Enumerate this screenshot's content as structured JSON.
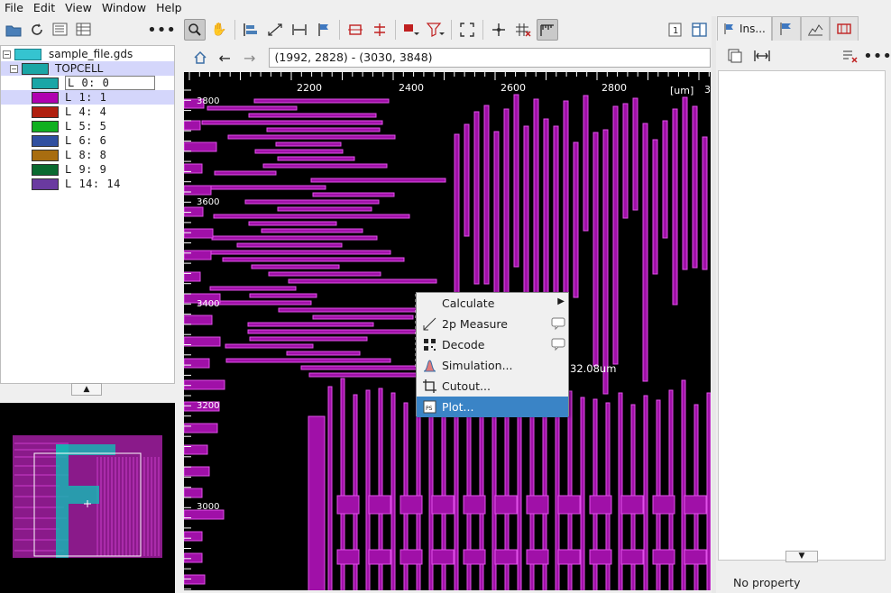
{
  "menubar": {
    "items": [
      {
        "label": "File"
      },
      {
        "label": "Edit"
      },
      {
        "label": "View"
      },
      {
        "label": "Window"
      },
      {
        "label": "Help"
      }
    ]
  },
  "left_toolbar": {
    "icons": [
      "open-folder-icon",
      "reload-icon",
      "layer-list-icon",
      "layer-table-icon",
      "more-options-icon"
    ]
  },
  "cell_tree": {
    "file_name": "sample_file.gds",
    "top_cell": "TOPCELL",
    "layers": [
      {
        "label": "L  0:  0",
        "color": "#1aa6a6",
        "selected": false,
        "boxed": true
      },
      {
        "label": "L  1:  1",
        "color": "#b000b0",
        "selected": true,
        "boxed": false
      },
      {
        "label": "L  4:  4",
        "color": "#b02010",
        "selected": false,
        "boxed": false
      },
      {
        "label": "L  5:  5",
        "color": "#10b020",
        "selected": false,
        "boxed": false
      },
      {
        "label": "L  6:  6",
        "color": "#3050a0",
        "selected": false,
        "boxed": false
      },
      {
        "label": "L  8:  8",
        "color": "#a86d10",
        "selected": false,
        "boxed": false
      },
      {
        "label": "L  9:  9",
        "color": "#0a6a30",
        "selected": false,
        "boxed": false
      },
      {
        "label": "L 14: 14",
        "color": "#6a3aa0",
        "selected": false,
        "boxed": false
      }
    ]
  },
  "navigation": {
    "coordinates": "(1992, 2828) - (3030, 3848)"
  },
  "ruler": {
    "x_ticks": [
      "2200",
      "2400",
      "2600",
      "2800"
    ],
    "unit": "[um]",
    "right_edge": "3",
    "y_ticks": [
      "3800",
      "3600",
      "3400",
      "3200",
      "3000"
    ]
  },
  "measurement_text": "32.08um",
  "context_menu": {
    "items": [
      {
        "label": "Calculate",
        "icon": "",
        "submenu": true,
        "active": false
      },
      {
        "label": "2p Measure",
        "icon": "measure-icon",
        "submenu": false,
        "active": false,
        "comment": true
      },
      {
        "label": "Decode",
        "icon": "qr-code-icon",
        "submenu": false,
        "active": false,
        "comment": true
      },
      {
        "label": "Simulation...",
        "icon": "simulation-icon",
        "submenu": false,
        "active": false
      },
      {
        "label": "Cutout...",
        "icon": "crop-icon",
        "submenu": false,
        "active": false
      },
      {
        "label": "Plot...",
        "icon": "plot-ps-icon",
        "submenu": false,
        "active": true
      }
    ]
  },
  "right_panel": {
    "tabs": [
      {
        "label": "Ins...",
        "icon": "inspector-icon",
        "active": true
      },
      {
        "label": "",
        "icon": "flag-icon",
        "active": false
      },
      {
        "label": "",
        "icon": "chart-icon",
        "active": false
      },
      {
        "label": "",
        "icon": "ruler-red-icon",
        "active": false
      }
    ],
    "empty_text": "No property"
  }
}
